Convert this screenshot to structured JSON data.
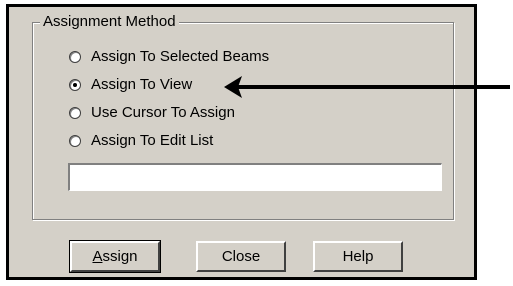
{
  "group": {
    "title": "Assignment Method"
  },
  "options": [
    {
      "label": "Assign To Selected Beams",
      "checked": false
    },
    {
      "label": "Assign To View",
      "checked": true
    },
    {
      "label": "Use Cursor To Assign",
      "checked": false
    },
    {
      "label": "Assign To Edit List",
      "checked": false
    }
  ],
  "edit_list": {
    "value": ""
  },
  "buttons": {
    "assign": {
      "mnemonic": "A",
      "rest": "ssign"
    },
    "close": "Close",
    "help": "Help"
  },
  "annotation": {
    "icon": "arrow-left-icon",
    "color": "#000000"
  }
}
